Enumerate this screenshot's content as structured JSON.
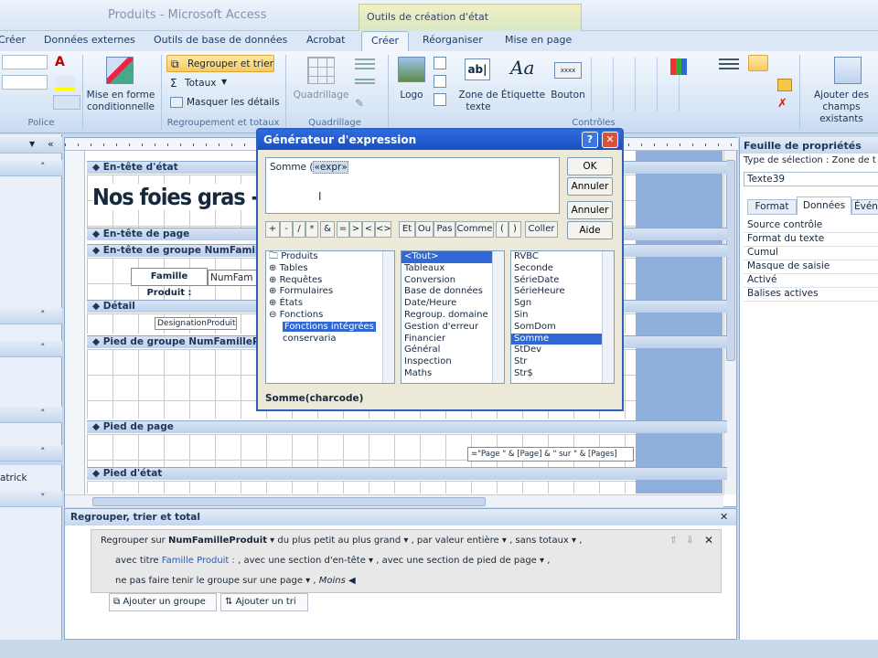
{
  "window": {
    "title": "Produits - Microsoft Access",
    "ctx_group": "Outils de création d'état"
  },
  "tabs": [
    {
      "label": "Créer"
    },
    {
      "label": "Données externes"
    },
    {
      "label": "Outils de base de données"
    },
    {
      "label": "Acrobat"
    },
    {
      "label": "Créer"
    },
    {
      "label": "Réorganiser"
    },
    {
      "label": "Mise en page"
    }
  ],
  "ribbon": {
    "police_label": "Police",
    "mise_en_forme": "Mise en forme conditionnelle",
    "regrouper_trier": "Regrouper et trier",
    "totaux": "Totaux",
    "masquer_details": "Masquer les détails",
    "regroupement_label": "Regroupement et totaux",
    "quadrillage": "Quadrillage",
    "quadrillage_label": "Quadrillage",
    "logo": "Logo",
    "zone_texte": "Zone de texte",
    "etiquette": "Étiquette",
    "bouton": "Bouton",
    "controles_label": "Contrôles",
    "ajouter_champs": "Ajouter des champs existants"
  },
  "left_pane": {
    "items": [
      "atrick"
    ]
  },
  "design": {
    "sections": [
      "En-tête d'état",
      "En-tête de page",
      "En-tête de groupe NumFamilleProduit",
      "Détail",
      "Pied de groupe NumFamilleProduit",
      "Pied de page",
      "Pied d'état"
    ],
    "report_title": "Nos foies gras - ",
    "famille_label": "Famille Produit :",
    "famille_field": "NumFam",
    "detail_field": "DesignationProduit",
    "page_expr": "=\"Page \" & [Page] & \" sur \" & [Pages]"
  },
  "dialog": {
    "title": "Générateur d'expression",
    "expression": "Somme (",
    "expression_arg": "«expr»",
    "ok": "OK",
    "annuler1": "Annuler",
    "annuler2": "Annuler",
    "aide": "Aide",
    "coller": "Coller",
    "operators": [
      "+",
      "-",
      "/",
      "*",
      "&",
      "=",
      ">",
      "<",
      "<>",
      "Et",
      "Ou",
      "Pas",
      "Comme",
      "(",
      ")"
    ],
    "tree": [
      "Produits",
      "Tables",
      "Requêtes",
      "Formulaires",
      "États",
      "Fonctions",
      "Fonctions intégrées",
      "conservaria"
    ],
    "categories": [
      "<Tout>",
      "Tableaux",
      "Conversion",
      "Base de données",
      "Date/Heure",
      "Regroup. domaine",
      "Gestion d'erreur",
      "Financier",
      "Général",
      "Inspection",
      "Maths"
    ],
    "functions": [
      "RVBC",
      "Seconde",
      "SérieDate",
      "SérieHeure",
      "Sgn",
      "Sin",
      "SomDom",
      "Somme",
      "StDev",
      "Str",
      "Str$"
    ],
    "syntax": "Somme(charcode)"
  },
  "props": {
    "title": "Feuille de propriétés",
    "selection_type": "Type de sélection : Zone de t",
    "selected": "Texte39",
    "tab_format": "Format",
    "tab_donnees": "Données",
    "tab_event": "Événe",
    "rows": [
      "Source contrôle",
      "Format du texte",
      "Cumul",
      "Masque de saisie",
      "Activé",
      "Balises actives"
    ]
  },
  "group_pane": {
    "title": "Regrouper, trier et total",
    "line1": {
      "prefix": "Regrouper sur",
      "field": "NumFamilleProduit",
      "order": "du plus petit au plus grand",
      "by": "par valeur entière",
      "totals": "sans totaux"
    },
    "line2": {
      "prefix": "avec titre",
      "title": "Famille Produit :",
      "header": "avec une section d'en-tête",
      "footer": "avec une section de pied de page"
    },
    "line3": {
      "keep": "ne pas faire tenir le groupe sur une page",
      "less": "Moins"
    },
    "add_group": "Ajouter un groupe",
    "add_sort": "Ajouter un tri"
  }
}
